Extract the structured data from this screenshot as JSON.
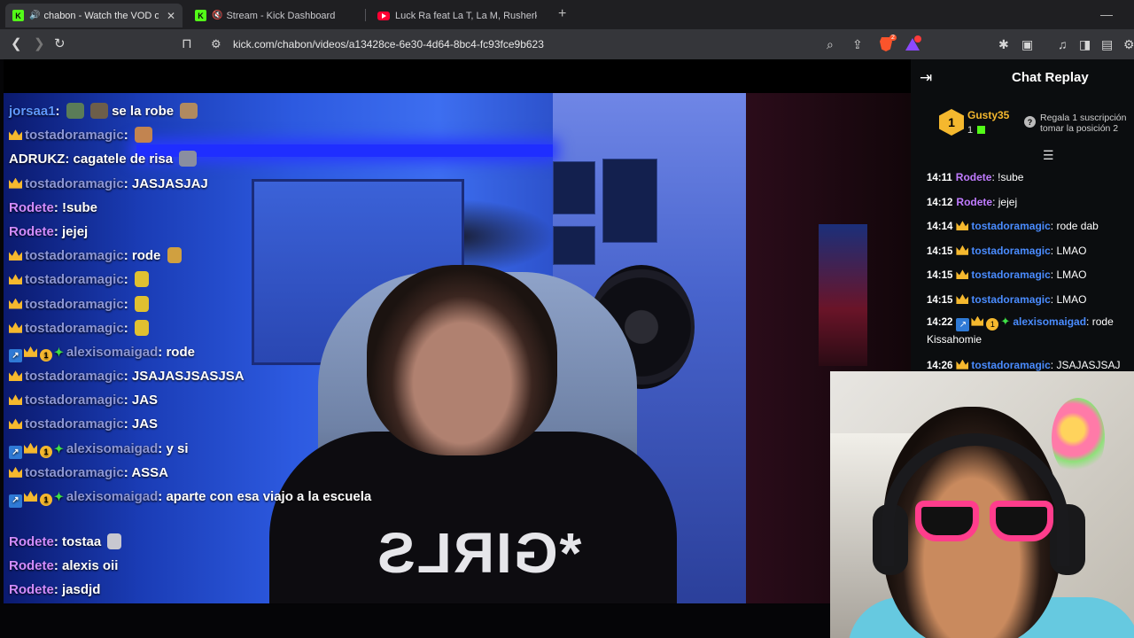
{
  "browser": {
    "tabs": [
      {
        "title": "chabon - Watch the VOD on K",
        "icon": "kick-icon",
        "audio": true,
        "active": true
      },
      {
        "title": "Stream - Kick Dashboard",
        "icon": "kick-icon",
        "audio": true,
        "active": false
      },
      {
        "title": "Luck Ra feat La T, La M, Rusherking -",
        "icon": "youtube-icon",
        "audio": false,
        "active": false
      }
    ],
    "url": "kick.com/chabon/videos/a13428ce-6e30-4d64-8bc4-fc93fce9b623",
    "brave_badge": "2"
  },
  "overlay_chat": [
    {
      "user": "jorsaa1",
      "text": "se la robe",
      "color": "blue"
    },
    {
      "user": "tostadoramagic",
      "text": "",
      "crown": true
    },
    {
      "user": "ADRUKZ",
      "text": "cagatele de risa",
      "color": "white"
    },
    {
      "user": "tostadoramagic",
      "text": "JASJASJAJ",
      "crown": true
    },
    {
      "user": "Rodete",
      "text": "!sube"
    },
    {
      "user": "Rodete",
      "text": "jejej"
    },
    {
      "user": "tostadoramagic",
      "text": "rode",
      "crown": true
    },
    {
      "user": "tostadoramagic",
      "text": "",
      "crown": true
    },
    {
      "user": "tostadoramagic",
      "text": "",
      "crown": true
    },
    {
      "user": "tostadoramagic",
      "text": "",
      "crown": true
    },
    {
      "user": "alexisomaigad",
      "text": "rode",
      "badges": true
    },
    {
      "user": "tostadoramagic",
      "text": "JSAJASJSASJSA",
      "crown": true
    },
    {
      "user": "tostadoramagic",
      "text": "JAS",
      "crown": true
    },
    {
      "user": "tostadoramagic",
      "text": "JAS",
      "crown": true
    },
    {
      "user": "alexisomaigad",
      "text": "y si",
      "badges": true
    },
    {
      "user": "tostadoramagic",
      "text": "ASSA",
      "crown": true
    },
    {
      "user": "alexisomaigad",
      "text": "aparte con esa viajo a la escuela",
      "badges": true
    },
    {
      "user": "Rodete",
      "text": "tostaa"
    },
    {
      "user": "Rodete",
      "text": "alexis oii"
    },
    {
      "user": "Rodete",
      "text": "jasdjd"
    }
  ],
  "chat_panel": {
    "title": "Chat Replay",
    "pinned": {
      "rank": "1",
      "user": "Gusty35",
      "count": "1",
      "note_line1": "Regala 1 suscripción",
      "note_line2": "tomar la posición 2"
    },
    "messages": [
      {
        "time": "14:11",
        "user": "Rodete",
        "text": "!sube"
      },
      {
        "time": "14:12",
        "user": "Rodete",
        "text": "jejej"
      },
      {
        "time": "14:14",
        "user": "tostadoramagic",
        "text": "rode dab",
        "crown": true
      },
      {
        "time": "14:15",
        "user": "tostadoramagic",
        "text": "LMAO",
        "crown": true
      },
      {
        "time": "14:15",
        "user": "tostadoramagic",
        "text": "LMAO",
        "crown": true
      },
      {
        "time": "14:15",
        "user": "tostadoramagic",
        "text": "LMAO",
        "crown": true
      },
      {
        "time": "14:22",
        "user": "alexisomaigad",
        "text": "rode Kissahomie",
        "badges": true
      },
      {
        "time": "14:26",
        "user": "tostadoramagic",
        "text": "JSAJASJSAJ",
        "crown": true
      }
    ]
  },
  "video": {
    "shirt_text": "*GIRLS"
  },
  "colors": {
    "kick_green": "#53fc18",
    "chat_purple": "#c07bff",
    "chat_blue": "#4a8cff",
    "crown_gold": "#f5b82e"
  }
}
